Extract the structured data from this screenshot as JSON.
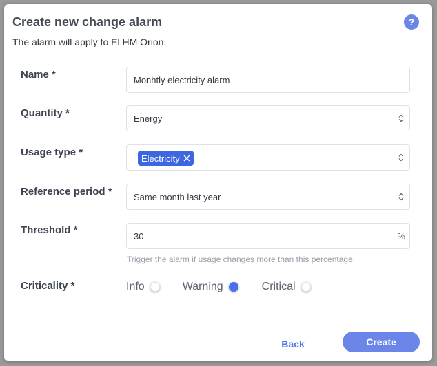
{
  "dialog": {
    "title": "Create new change alarm",
    "help_icon": "?",
    "subtitle": "The alarm will apply to El HM Orion."
  },
  "form": {
    "name": {
      "label": "Name *",
      "value": "Monhtly electricity alarm"
    },
    "quantity": {
      "label": "Quantity *",
      "value": "Energy"
    },
    "usage_type": {
      "label": "Usage type *",
      "tag": "Electricity"
    },
    "reference_period": {
      "label": "Reference period *",
      "value": "Same month last year"
    },
    "threshold": {
      "label": "Threshold *",
      "value": "30",
      "unit": "%",
      "hint": "Trigger the alarm if usage changes more than this percentage."
    },
    "criticality": {
      "label": "Criticality *",
      "options": [
        {
          "label": "Info",
          "checked": false
        },
        {
          "label": "Warning",
          "checked": true
        },
        {
          "label": "Critical",
          "checked": false
        }
      ]
    }
  },
  "actions": {
    "back_label": "Back",
    "create_label": "Create"
  },
  "colors": {
    "accent": "#6b85e8",
    "tag": "#3d67e0",
    "radio_checked": "#4a6ef0"
  }
}
